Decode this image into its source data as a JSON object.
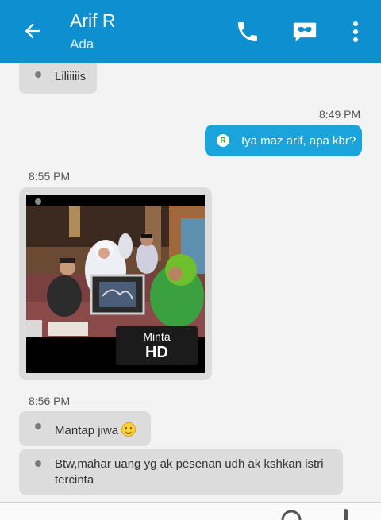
{
  "header": {
    "title": "Arif R",
    "status": "Ada",
    "accent_color": "#0e8fd0",
    "icons": [
      "arrow-back-icon",
      "phone-icon",
      "chat-mask-icon",
      "more-vert-icon"
    ]
  },
  "messages": [
    {
      "direction": "in",
      "text": "Liliiiiis"
    },
    {
      "direction": "out",
      "time": "8:49 PM",
      "sender_badge": "R",
      "text": "Iya maz arif, apa kbr?"
    },
    {
      "direction": "in",
      "time": "8:55 PM",
      "type": "image",
      "hd_label_line1": "Minta",
      "hd_label_line2": "HD"
    },
    {
      "direction": "in",
      "time": "8:56 PM",
      "text": "Mantap jiwa",
      "emoji": "smiley-icon"
    },
    {
      "direction": "in",
      "text": "Btw,mahar uang yg ak pesenan udh ak kshkan istri tercinta"
    }
  ]
}
